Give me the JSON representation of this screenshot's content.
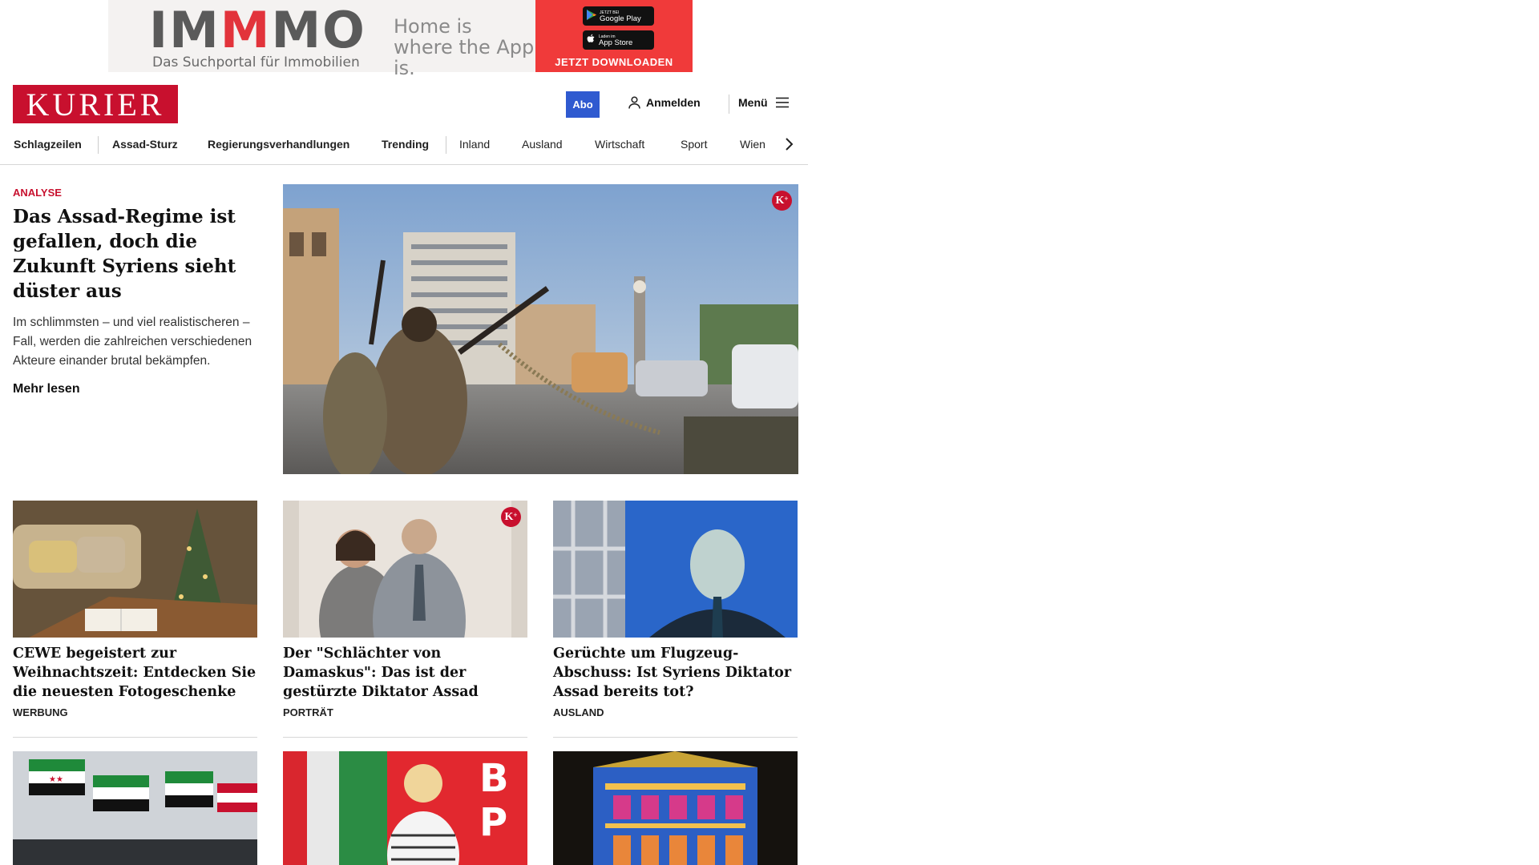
{
  "ad": {
    "logo_a": "IM",
    "logo_b": "M",
    "logo_c": "MO",
    "tagline": "Das Suchportal für Immobilien",
    "claim": "Home is where the App is.",
    "google_small": "JETZT BEI",
    "google_big": "Google Play",
    "apple_small": "Laden im",
    "apple_big": "App Store",
    "cta": "JETZT DOWNLOADEN"
  },
  "header": {
    "logo": "KURIER",
    "abo": "Abo",
    "login": "Anmelden",
    "menu": "Menü"
  },
  "nav": {
    "items": [
      "Schlagzeilen",
      "Assad-Sturz",
      "Regierungsverhandlungen",
      "Trending",
      "Inland",
      "Ausland",
      "Wirtschaft",
      "Sport",
      "Wien"
    ]
  },
  "lead": {
    "kicker": "ANALYSE",
    "title": "Das Assad-Regime ist ge­fallen, doch die Zukunft Syriens sieht düster aus",
    "teaser": "Im schlimmsten – und viel realistischeren – Fall, werden die zahlreichen verschiedenen Akteure einander brutal bekämpfen.",
    "readmore": "Mehr lesen",
    "premium": "K"
  },
  "cards": [
    {
      "title": "CEWE begeistert zur Weihnachts­zeit: Entdecken Sie die neuesten Fotogeschenke",
      "tag": "WERBUNG"
    },
    {
      "title": "Der \"Schlächter von Damaskus\": Das ist der gestürzte Diktator Assad",
      "tag": "PORTRÄT"
    },
    {
      "title": "Gerüchte um Flugzeug-Abschuss: Ist Syriens Diktator Assad bereits tot?",
      "tag": "AUSLAND"
    }
  ],
  "colors": {
    "brand_red": "#c8102e",
    "abo_blue": "#2f5ad0",
    "ad_red": "#f03a3a"
  }
}
